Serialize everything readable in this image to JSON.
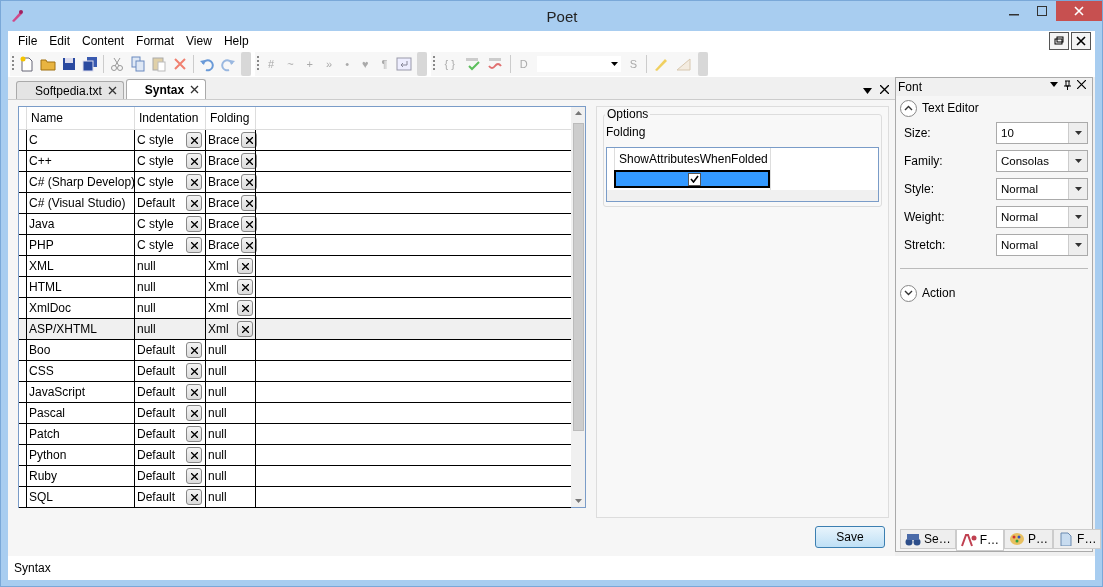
{
  "window": {
    "title": "Poet"
  },
  "menu": [
    "File",
    "Edit",
    "Content",
    "Format",
    "View",
    "Help"
  ],
  "toolbar": {
    "format_glyphs": [
      "#",
      "~",
      "+",
      "»",
      "•",
      "♥",
      "¶"
    ],
    "braces": "{ }",
    "d_label": "D",
    "s_label": "S"
  },
  "doc_tabs": [
    {
      "label": "Softpedia.txt",
      "selected": false
    },
    {
      "label": "Syntax",
      "selected": true
    }
  ],
  "syntax_table": {
    "columns": [
      "Name",
      "Indentation",
      "Folding"
    ],
    "rows": [
      {
        "name": "C",
        "indentation": {
          "value": "C style",
          "clearable": true
        },
        "folding": {
          "value": "Brace",
          "clearable": true
        },
        "selected": false
      },
      {
        "name": "C++",
        "indentation": {
          "value": "C style",
          "clearable": true
        },
        "folding": {
          "value": "Brace",
          "clearable": true
        },
        "selected": false
      },
      {
        "name": "C# (Sharp Develop)",
        "indentation": {
          "value": "C style",
          "clearable": true
        },
        "folding": {
          "value": "Brace",
          "clearable": true
        },
        "selected": false
      },
      {
        "name": "C# (Visual Studio)",
        "indentation": {
          "value": "Default",
          "clearable": true
        },
        "folding": {
          "value": "Brace",
          "clearable": true
        },
        "selected": false
      },
      {
        "name": "Java",
        "indentation": {
          "value": "C style",
          "clearable": true
        },
        "folding": {
          "value": "Brace",
          "clearable": true
        },
        "selected": false
      },
      {
        "name": "PHP",
        "indentation": {
          "value": "C style",
          "clearable": true
        },
        "folding": {
          "value": "Brace",
          "clearable": true
        },
        "selected": false
      },
      {
        "name": "XML",
        "indentation": {
          "value": "null",
          "clearable": false
        },
        "folding": {
          "value": "Xml",
          "clearable": true
        },
        "selected": false
      },
      {
        "name": "HTML",
        "indentation": {
          "value": "null",
          "clearable": false
        },
        "folding": {
          "value": "Xml",
          "clearable": true
        },
        "selected": false
      },
      {
        "name": "XmlDoc",
        "indentation": {
          "value": "null",
          "clearable": false
        },
        "folding": {
          "value": "Xml",
          "clearable": true
        },
        "selected": false
      },
      {
        "name": "ASP/XHTML",
        "indentation": {
          "value": "null",
          "clearable": false
        },
        "folding": {
          "value": "Xml",
          "clearable": true
        },
        "selected": true
      },
      {
        "name": "Boo",
        "indentation": {
          "value": "Default",
          "clearable": true
        },
        "folding": {
          "value": "null",
          "clearable": false
        },
        "selected": false
      },
      {
        "name": "CSS",
        "indentation": {
          "value": "Default",
          "clearable": true
        },
        "folding": {
          "value": "null",
          "clearable": false
        },
        "selected": false
      },
      {
        "name": "JavaScript",
        "indentation": {
          "value": "Default",
          "clearable": true
        },
        "folding": {
          "value": "null",
          "clearable": false
        },
        "selected": false
      },
      {
        "name": "Pascal",
        "indentation": {
          "value": "Default",
          "clearable": true
        },
        "folding": {
          "value": "null",
          "clearable": false
        },
        "selected": false
      },
      {
        "name": "Patch",
        "indentation": {
          "value": "Default",
          "clearable": true
        },
        "folding": {
          "value": "null",
          "clearable": false
        },
        "selected": false
      },
      {
        "name": "Python",
        "indentation": {
          "value": "Default",
          "clearable": true
        },
        "folding": {
          "value": "null",
          "clearable": false
        },
        "selected": false
      },
      {
        "name": "Ruby",
        "indentation": {
          "value": "Default",
          "clearable": true
        },
        "folding": {
          "value": "null",
          "clearable": false
        },
        "selected": false
      },
      {
        "name": "SQL",
        "indentation": {
          "value": "Default",
          "clearable": true
        },
        "folding": {
          "value": "null",
          "clearable": false
        },
        "selected": false
      }
    ]
  },
  "options": {
    "title": "Options",
    "section": "Folding",
    "column": "ShowAttributesWhenFolded",
    "row": {
      "checked": true,
      "selected": true
    }
  },
  "save_button": "Save",
  "font_panel": {
    "title": "Font",
    "sections": [
      {
        "title": "Text Editor",
        "expanded": true,
        "properties": [
          {
            "label": "Size:",
            "value": "10"
          },
          {
            "label": "Family:",
            "value": "Consolas"
          },
          {
            "label": "Style:",
            "value": "Normal"
          },
          {
            "label": "Weight:",
            "value": "Normal"
          },
          {
            "label": "Stretch:",
            "value": "Normal"
          }
        ]
      },
      {
        "title": "Action",
        "expanded": false
      }
    ],
    "bottom_tabs": [
      {
        "label": "Se…",
        "selected": false
      },
      {
        "label": "F…",
        "selected": true
      },
      {
        "label": "P…",
        "selected": false
      },
      {
        "label": "F…",
        "selected": false
      }
    ]
  },
  "status_bar": "Syntax"
}
